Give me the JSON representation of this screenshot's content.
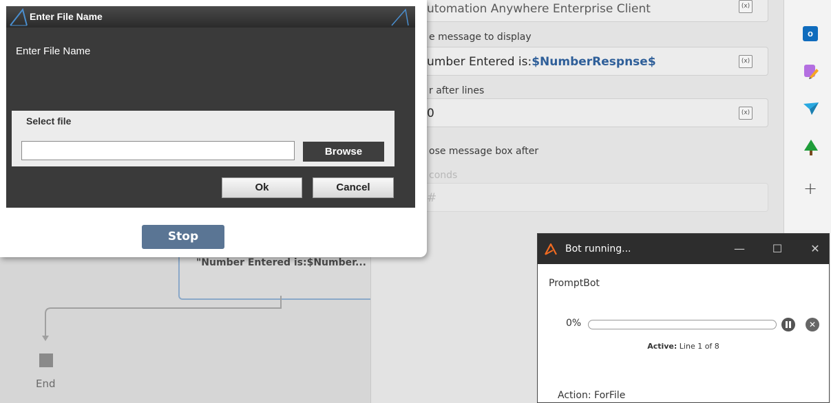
{
  "props": {
    "field1_text": "utomation Anywhere Enterprise Client",
    "label_message": "e message to display",
    "field2_prefix": "umber Entered is:",
    "field2_var": "$NumberRespnse$",
    "label_after_lines": "r after lines",
    "field3_text": "0",
    "label_close": "ose message box after",
    "label_seconds": "conds",
    "field4_text": "#",
    "fx_label": "(x)"
  },
  "flow": {
    "node_text": "\"Number Entered is:$Number...",
    "end_label": "End"
  },
  "dialog": {
    "title": "Enter File Name",
    "prompt": "Enter File Name",
    "select_file_label": "Select file",
    "file_input_value": "",
    "browse_label": "Browse",
    "ok_label": "Ok",
    "cancel_label": "Cancel",
    "stop_label": "Stop"
  },
  "bot": {
    "title": "Bot running...",
    "name": "PromptBot",
    "progress_percent_text": "0%",
    "progress": 0,
    "active_label": "Active:",
    "active_value": "Line 1 of 8",
    "action_text": "Action: ForFile"
  },
  "rail": {
    "icons": [
      "outlook-icon",
      "paint-icon",
      "send-icon",
      "tree-icon",
      "plus-icon"
    ]
  },
  "colors": {
    "accent_blue": "#2f5f99",
    "stop_button": "#5a7594",
    "dialog_dark": "#3a3a3a",
    "bot_titlebar": "#2d2d2d"
  }
}
